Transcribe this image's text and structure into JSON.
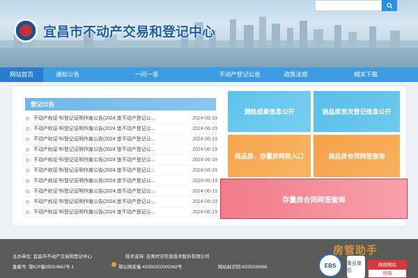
{
  "header": {
    "site_title": "宜昌市不动产交易和登记中心",
    "search_placeholder": ""
  },
  "nav": {
    "items": [
      {
        "label": "网站首页",
        "active": true
      },
      {
        "label": "通知公告",
        "active": false
      },
      {
        "label": "一问一答",
        "active": false
      },
      {
        "label": "不动产登记公告",
        "active": false
      },
      {
        "label": "政策法规",
        "active": false
      },
      {
        "label": "相关下载",
        "active": false
      }
    ]
  },
  "notice": {
    "tab_label": "登记公告",
    "items": [
      {
        "text": "不动产权证书/登记证明作废公告(2024 宜不动产登记公...",
        "date": "2024-06-19"
      },
      {
        "text": "不动产权证书/登记证明作废公告(2024 宜不动产登记公...",
        "date": "2024-06-19"
      },
      {
        "text": "不动产权证书/登记证明作废公告(2024 宜不动产登记公...",
        "date": "2024-06-19"
      },
      {
        "text": "不动产权证书/登记证明作废公告(2024 宜不动产登记公...",
        "date": "2024-06-19"
      },
      {
        "text": "不动产权证书/登记证明作废公告(2024 宜不动产登记公...",
        "date": "2024-06-19"
      },
      {
        "text": "不动产权证书/登记证明作废公告(2024 宜不动产登记公...",
        "date": "2024-06-19"
      },
      {
        "text": "不动产权证书/登记证明作废公告(2024 宜不动产登记公...",
        "date": "2024-06-19"
      },
      {
        "text": "不动产权证书/登记证明作废公告(2024 宜不动产登记公...",
        "date": "2024-06-19"
      },
      {
        "text": "不动产权证书/登记证明作废公告(2024 宜不动产登记公...",
        "date": "2024-06-19"
      },
      {
        "text": "不动产权证书/登记证明作废公告(2024 宜不动产登记公...",
        "date": "2024-06-19"
      }
    ]
  },
  "tiles": {
    "survey": "测绘成果信息公开",
    "first_reg": "商品房首次登记信息公开",
    "online_sign": "商品房、存量房网签入口",
    "contract_query": "商品房合同网签查询",
    "stock_query": "存量房合同网签查询"
  },
  "footer": {
    "host": "主办单位:    宜昌市不动产交易和登记中心",
    "support": "技术支持:    吉奥时空信息技术股份有限公司",
    "icp": "备案号:  鄂ICP备05010662号-1",
    "police": "鄂公网安备 42050202000342号",
    "site_id": "网站标识码:4205000066",
    "badge_ebs": "EBS",
    "badge_wt": "事业单位",
    "err_top": "政府网站",
    "err_bottom": "找错",
    "watermark": "房管助手"
  },
  "colors": {
    "nav_bg": "#3b9be4",
    "nav_active": "#2b7ccf",
    "tile_blue": "#5fc2ec",
    "tile_orange": "#f7a54b",
    "tile_pink": "#f37a8a",
    "footer_bg": "#5a5a5a"
  },
  "icons": {
    "search": "search-icon",
    "emblem": "emblem-icon",
    "police": "police-badge-icon"
  }
}
